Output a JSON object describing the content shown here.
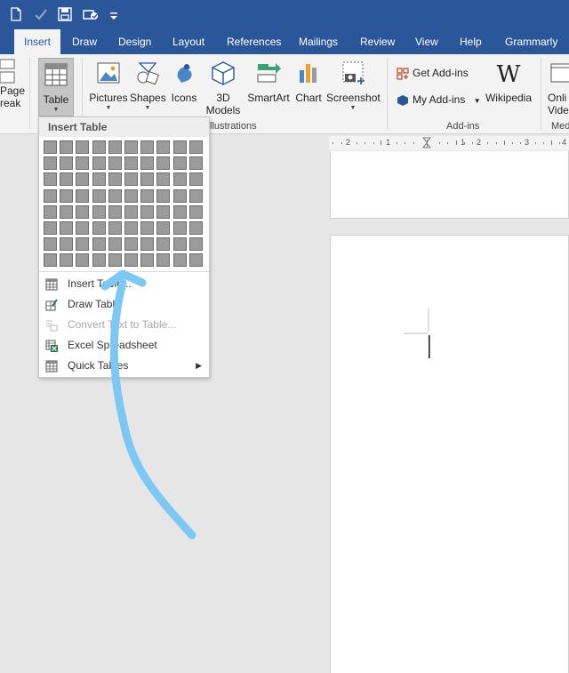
{
  "quick_access": {
    "icons": [
      "new-document-icon",
      "spelling-check-icon",
      "save-icon",
      "touch-mode-icon",
      "customize-icon"
    ]
  },
  "tabs": [
    {
      "label": "Insert",
      "active": true
    },
    {
      "label": "Draw"
    },
    {
      "label": "Design"
    },
    {
      "label": "Layout"
    },
    {
      "label": "References"
    },
    {
      "label": "Mailings"
    },
    {
      "label": "Review"
    },
    {
      "label": "View"
    },
    {
      "label": "Help"
    },
    {
      "label": "Grammarly"
    }
  ],
  "ribbon": {
    "page_break": {
      "line1": "Page",
      "line2": "reak"
    },
    "table": {
      "label": "Table"
    },
    "pictures": {
      "label": "Pictures"
    },
    "shapes": {
      "label": "Shapes"
    },
    "icons": {
      "label": "Icons"
    },
    "models3d": {
      "line1": "3D",
      "line2": "Models"
    },
    "smartart": {
      "label": "SmartArt"
    },
    "chart": {
      "label": "Chart"
    },
    "screenshot": {
      "label": "Screenshot"
    },
    "illustrations_group": "llustrations",
    "get_addins": "Get Add-ins",
    "my_addins": "My Add-ins",
    "wikipedia": "Wikipedia",
    "addins_group": "Add-ins",
    "online_video": {
      "line1": "Onli",
      "line2": "Vide"
    },
    "media_group": "Med"
  },
  "ruler": {
    "labels": [
      "2",
      "1",
      "1",
      "2",
      "3",
      "4"
    ]
  },
  "dropdown": {
    "title": "Insert Table",
    "grid": {
      "columns": 10,
      "rows": 8
    },
    "items": [
      {
        "label": "Insert Table...",
        "icon": "insert-table-icon",
        "enabled": true
      },
      {
        "label": "Draw Table",
        "icon": "draw-table-icon",
        "enabled": true
      },
      {
        "label": "Convert Text to Table...",
        "icon": "convert-text-icon",
        "enabled": false
      },
      {
        "label": "Excel Spreadsheet",
        "icon": "excel-icon",
        "enabled": true
      },
      {
        "label": "Quick Tables",
        "icon": "quick-tables-icon",
        "enabled": true,
        "submenu": true
      }
    ]
  },
  "colors": {
    "title_bar": "#2b579a",
    "ribbon": "#f3f3f3",
    "annotation_arrow": "#7cc7f3"
  }
}
